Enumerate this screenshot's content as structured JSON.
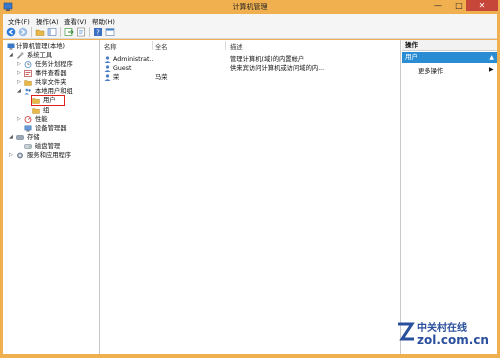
{
  "window": {
    "title": "计算机管理",
    "controls": {
      "minimize": "—",
      "maximize": "□",
      "close": "✕"
    }
  },
  "menu": [
    "文件(F)",
    "操作(A)",
    "查看(V)",
    "帮助(H)"
  ],
  "toolbar": [
    "back-arrow-icon",
    "forward-arrow-icon",
    "folder-up-icon",
    "show-tree-icon",
    "export-icon",
    "properties-icon",
    "help-icon",
    "console-icon"
  ],
  "tree": {
    "root": "计算机管理(本地)",
    "system_tools": "系统工具",
    "task_scheduler": "任务计划程序",
    "event_viewer": "事件查看器",
    "shared_folders": "共享文件夹",
    "local_users": "本地用户和组",
    "users": "用户",
    "groups": "组",
    "performance": "性能",
    "device_manager": "设备管理器",
    "storage": "存储",
    "disk_management": "磁盘管理",
    "services_apps": "服务和应用程序"
  },
  "list": {
    "columns": {
      "name": "名称",
      "fullname": "全名",
      "description": "描述"
    },
    "rows": [
      {
        "name": "Administrat...",
        "fullname": "",
        "description": "管理计算机(域)的内置帐户"
      },
      {
        "name": "Guest",
        "fullname": "",
        "description": "供来宾访问计算机或访问域的内..."
      },
      {
        "name": "荣",
        "fullname": "马荣",
        "description": ""
      }
    ]
  },
  "actions": {
    "header": "操作",
    "section": "用户",
    "section_arrow": "▲",
    "more": "更多操作",
    "more_arrow": "▶"
  },
  "watermark": {
    "line1": "中关村在线",
    "line2": "zol.com.cn"
  },
  "colors": {
    "frame": "#f0b050",
    "selection_border": "#e02020",
    "action_section": "#2a8dd4",
    "close_button": "#c7463a",
    "watermark": "#2a4f9c"
  }
}
